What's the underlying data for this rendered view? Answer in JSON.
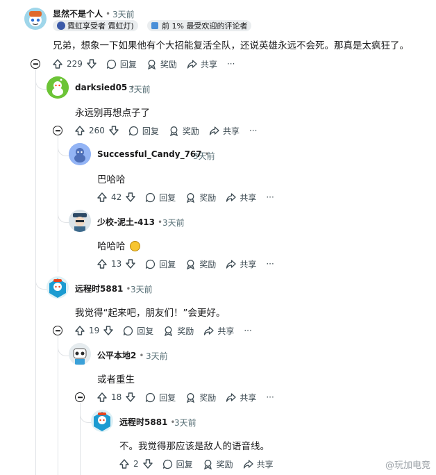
{
  "comments": [
    {
      "user": "显然不是个人",
      "time": "3天前",
      "flair1": "霓虹享受者 霓虹灯)",
      "flair2": "前 1% 最受欢迎的评论者",
      "body": "兄弟，想象一下如果他有个大招能复活全队，还说英雄永远不会死。那真是太疯狂了。",
      "votes": "229"
    },
    {
      "user": "darksied05",
      "time": "3天前",
      "body": "永远别再想点子了",
      "votes": "260"
    },
    {
      "user": "Successful_Candy_767",
      "time": "3天前",
      "body": "巴哈哈",
      "votes": "42"
    },
    {
      "user": "少校-泥土-413",
      "time": "3天前",
      "body": "哈哈哈",
      "votes": "13"
    },
    {
      "user": "远程时5881",
      "time": "3天前",
      "body": "我觉得“起来吧，朋友们！”会更好。",
      "votes": "19"
    },
    {
      "user": "公平本地2",
      "time": "3天前",
      "body": "或者重生",
      "votes": "18"
    },
    {
      "user": "远程时5881",
      "time": "3天前",
      "body": "不。我觉得那应该是敌人的语音线。",
      "votes": "2"
    }
  ],
  "labels": {
    "reply": "回复",
    "award": "奖励",
    "share": "共享",
    "more": "···"
  },
  "watermark": "@玩加电竞",
  "colors": {
    "accent": "#0079d3",
    "text": "#1a1a1b",
    "meta": "#576f76",
    "line": "#e0e3e6"
  }
}
